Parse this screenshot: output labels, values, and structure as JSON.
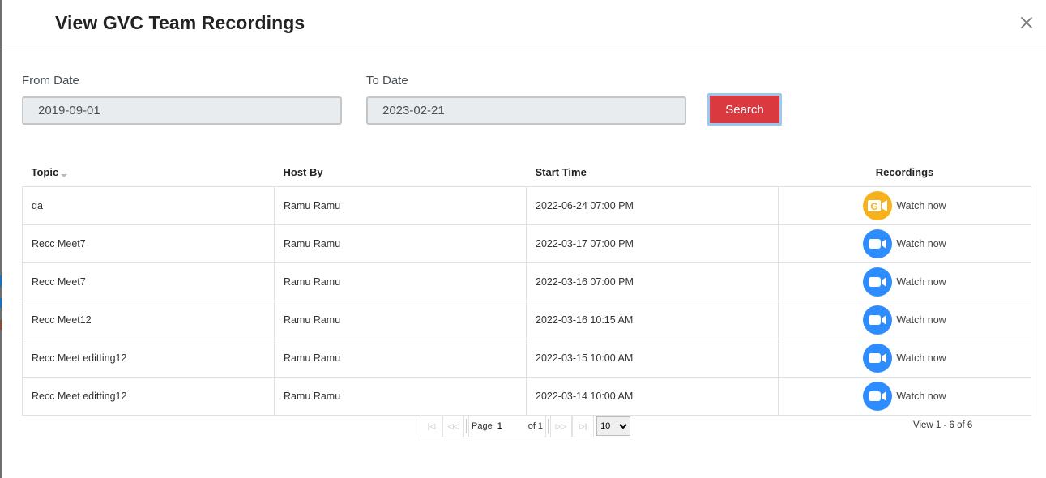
{
  "modal": {
    "title": "View GVC Team Recordings"
  },
  "filters": {
    "from_label": "From Date",
    "from_value": "2019-09-01",
    "to_label": "To Date",
    "to_value": "2023-02-21",
    "search_label": "Search"
  },
  "table": {
    "columns": [
      "Topic",
      "Host By",
      "Start Time",
      "Recordings"
    ],
    "rows": [
      {
        "topic": "qa",
        "host": "Ramu Ramu",
        "start": "2022-06-24 07:00 PM",
        "icon": "gvc-logo-icon",
        "watch": "Watch now"
      },
      {
        "topic": "Recc Meet7",
        "host": "Ramu Ramu",
        "start": "2022-03-17 07:00 PM",
        "icon": "zoom-video-icon",
        "watch": "Watch now"
      },
      {
        "topic": "Recc Meet7",
        "host": "Ramu Ramu",
        "start": "2022-03-16 07:00 PM",
        "icon": "zoom-video-icon",
        "watch": "Watch now"
      },
      {
        "topic": "Recc Meet12",
        "host": "Ramu Ramu",
        "start": "2022-03-16 10:15 AM",
        "icon": "zoom-video-icon",
        "watch": "Watch now"
      },
      {
        "topic": "Recc Meet editting12",
        "host": "Ramu Ramu",
        "start": "2022-03-15 10:00 AM",
        "icon": "zoom-video-icon",
        "watch": "Watch now"
      },
      {
        "topic": "Recc Meet editting12",
        "host": "Ramu Ramu",
        "start": "2022-03-14 10:00 AM",
        "icon": "zoom-video-icon",
        "watch": "Watch now"
      }
    ]
  },
  "pager": {
    "page_label": "Page",
    "page_value": "1",
    "of_label": "of 1",
    "rows_per_page": "10",
    "view_info": "View 1 - 6 of 6"
  },
  "colors": {
    "search": "#d9393f",
    "zoom": "#2d8cff",
    "gvc": "#f7b21b"
  }
}
